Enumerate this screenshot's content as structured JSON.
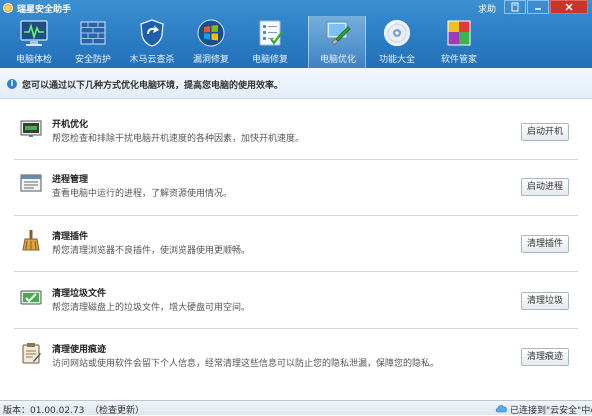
{
  "window": {
    "title": "瑞星安全助手",
    "help_label": "求助",
    "controls": [
      "restore-icon",
      "minimize-icon",
      "close-icon"
    ]
  },
  "tabs": [
    {
      "label": "电脑体检",
      "icon": "monitor-checkup-icon",
      "active": false
    },
    {
      "label": "安全防护",
      "icon": "firewall-icon",
      "active": false
    },
    {
      "label": "木马云查杀",
      "icon": "shield-icon",
      "active": false
    },
    {
      "label": "漏洞修复",
      "icon": "windows-logo-icon",
      "active": false
    },
    {
      "label": "电脑修复",
      "icon": "checklist-icon",
      "active": false
    },
    {
      "label": "电脑优化",
      "icon": "optimize-icon",
      "active": true
    },
    {
      "label": "功能大全",
      "icon": "disc-icon",
      "active": false
    },
    {
      "label": "软件管家",
      "icon": "software-manager-icon",
      "active": false
    }
  ],
  "info": {
    "text": "您可以通过以下几种方式优化电脑环境，提高您电脑的使用效率。",
    "icon": "info-icon"
  },
  "items": [
    {
      "title": "开机优化",
      "desc": "帮您检查和排除干扰电脑开机速度的各种因素，加快开机速度。",
      "button": "启动开机",
      "icon": "startup-icon"
    },
    {
      "title": "进程管理",
      "desc": "查看电脑中运行的进程，了解资源使用情况。",
      "button": "启动进程",
      "icon": "process-window-icon"
    },
    {
      "title": "清理插件",
      "desc": "帮您清理浏览器不良插件，使浏览器使用更顺畅。",
      "button": "清理插件",
      "icon": "broom-icon"
    },
    {
      "title": "清理垃圾文件",
      "desc": "帮您清理磁盘上的垃圾文件，增大硬盘可用空间。",
      "button": "清理垃圾",
      "icon": "disk-clean-icon"
    },
    {
      "title": "清理使用痕迹",
      "desc": "访问网站或使用软件会留下个人信息，经常清理这些信息可以防止您的隐私泄漏，保障您的隐私。",
      "button": "清理痕迹",
      "icon": "clipboard-icon"
    }
  ],
  "status": {
    "version": "版本：01.00.02.73",
    "check_update": "（检查更新）",
    "connected": "已连接到\"云安全\"中心",
    "icon": "cloud-icon"
  }
}
